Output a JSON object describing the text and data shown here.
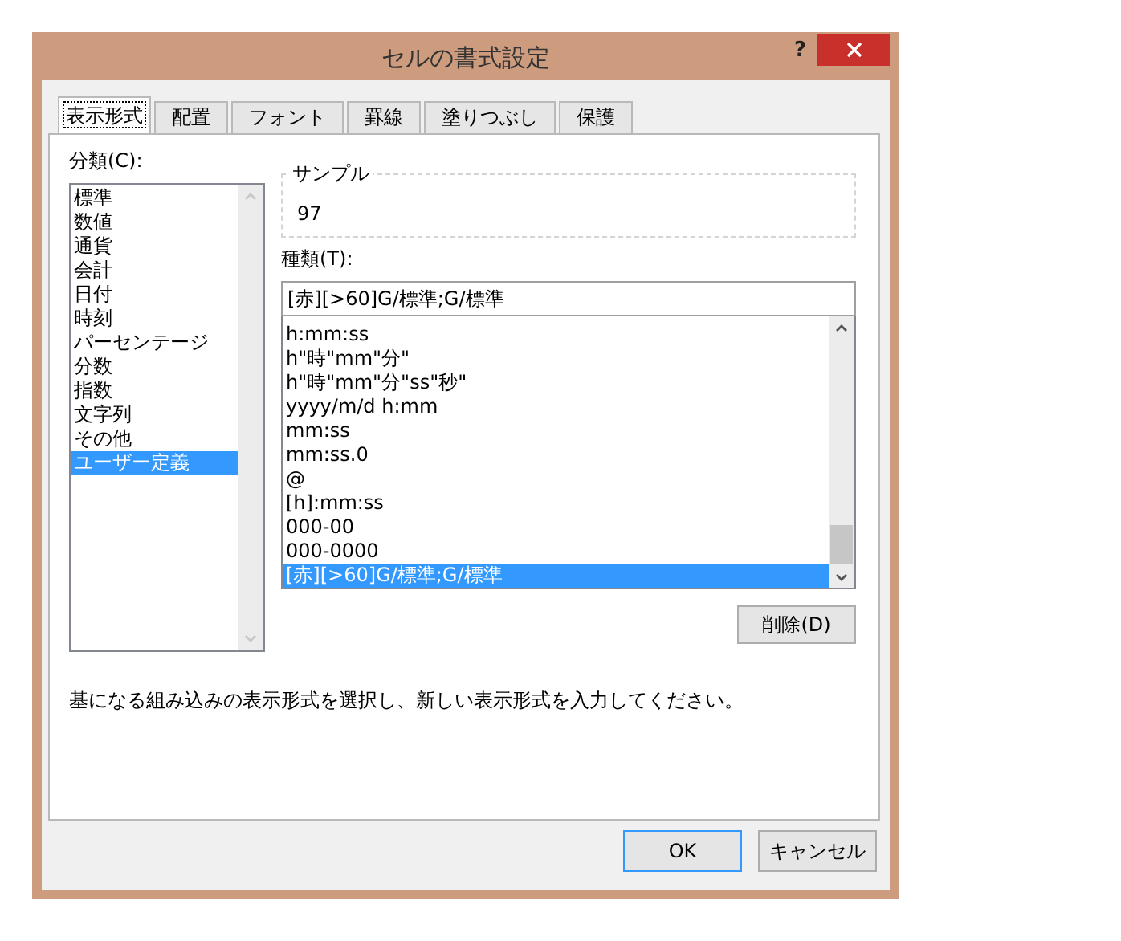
{
  "window": {
    "title": "セルの書式設定",
    "help": "?"
  },
  "tabs": [
    {
      "label": "表示形式",
      "selected": true
    },
    {
      "label": "配置",
      "selected": false
    },
    {
      "label": "フォント",
      "selected": false
    },
    {
      "label": "罫線",
      "selected": false
    },
    {
      "label": "塗りつぶし",
      "selected": false
    },
    {
      "label": "保護",
      "selected": false
    }
  ],
  "category": {
    "label": "分類(C):",
    "items": [
      {
        "label": "標準",
        "selected": false
      },
      {
        "label": "数値",
        "selected": false
      },
      {
        "label": "通貨",
        "selected": false
      },
      {
        "label": "会計",
        "selected": false
      },
      {
        "label": "日付",
        "selected": false
      },
      {
        "label": "時刻",
        "selected": false
      },
      {
        "label": "パーセンテージ",
        "selected": false
      },
      {
        "label": "分数",
        "selected": false
      },
      {
        "label": "指数",
        "selected": false
      },
      {
        "label": "文字列",
        "selected": false
      },
      {
        "label": "その他",
        "selected": false
      },
      {
        "label": "ユーザー定義",
        "selected": true
      }
    ]
  },
  "sample": {
    "legend": "サンプル",
    "value": "97"
  },
  "type": {
    "label": "種類(T):",
    "value": "[赤][>60]G/標準;G/標準",
    "items": [
      {
        "label": "h:mm:ss",
        "selected": false
      },
      {
        "label": "h\"時\"mm\"分\"",
        "selected": false
      },
      {
        "label": "h\"時\"mm\"分\"ss\"秒\"",
        "selected": false
      },
      {
        "label": "yyyy/m/d h:mm",
        "selected": false
      },
      {
        "label": "mm:ss",
        "selected": false
      },
      {
        "label": "mm:ss.0",
        "selected": false
      },
      {
        "label": "@",
        "selected": false
      },
      {
        "label": "[h]:mm:ss",
        "selected": false
      },
      {
        "label": "000-00",
        "selected": false
      },
      {
        "label": "000-0000",
        "selected": false
      },
      {
        "label": "[赤][>60]G/標準;G/標準",
        "selected": true
      }
    ]
  },
  "delete_button": "削除(D)",
  "hint": "基になる組み込みの表示形式を選択し、新しい表示形式を入力してください。",
  "buttons": [
    {
      "label": "OK",
      "default": true
    },
    {
      "label": "キャンセル",
      "default": false
    }
  ]
}
